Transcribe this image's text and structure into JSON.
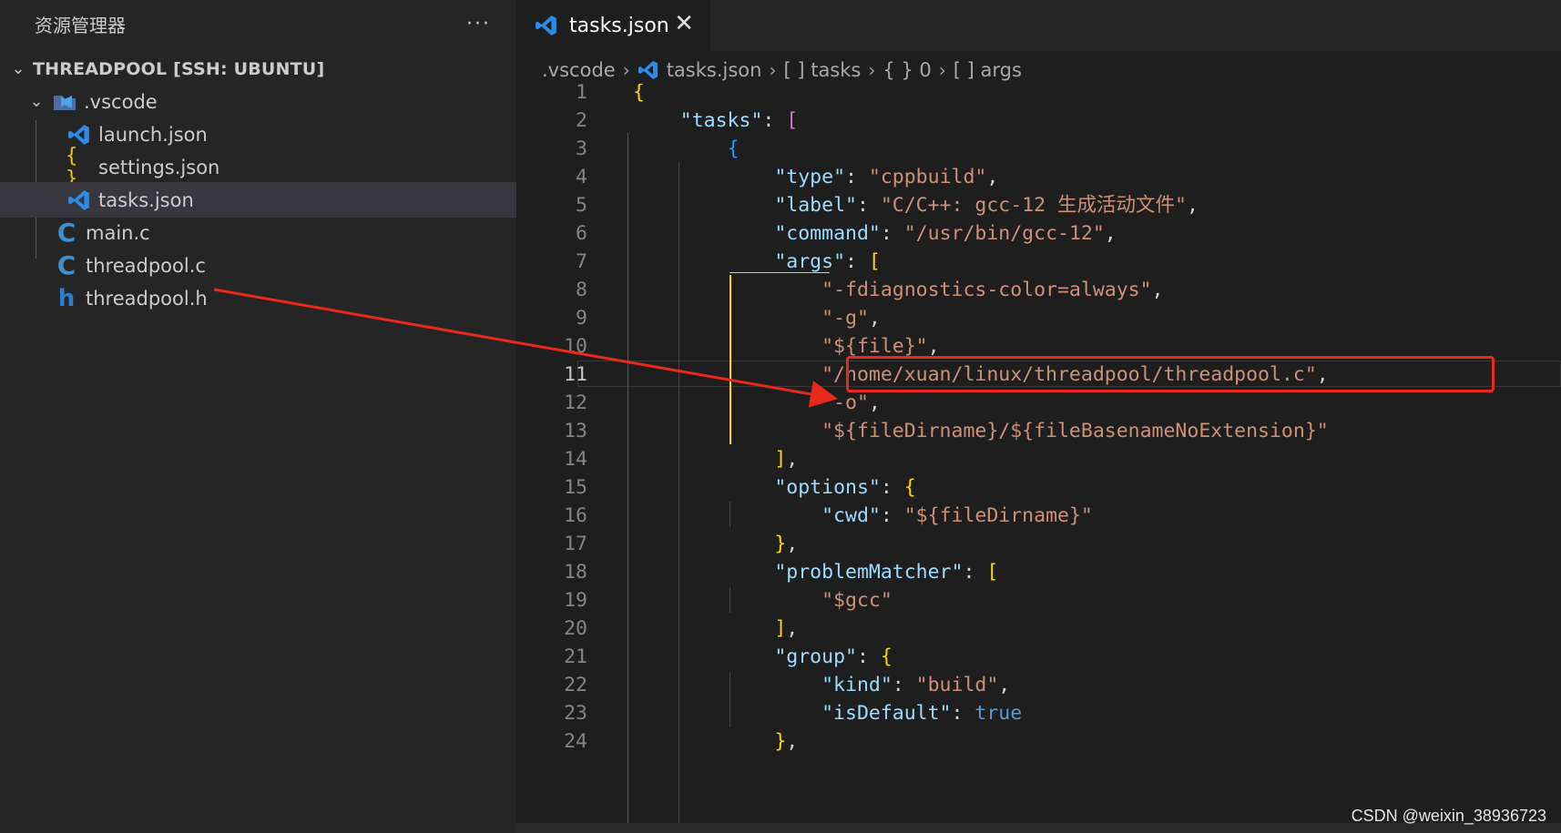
{
  "sidebar": {
    "title": "资源管理器",
    "more": "···",
    "root_label": "THREADPOOL [SSH: UBUNTU]",
    "items": [
      {
        "label": ".vscode",
        "type": "folder"
      },
      {
        "label": "launch.json",
        "type": "vscode-json"
      },
      {
        "label": "settings.json",
        "type": "json"
      },
      {
        "label": "tasks.json",
        "type": "vscode-json",
        "selected": true
      },
      {
        "label": "main.c",
        "type": "c"
      },
      {
        "label": "threadpool.c",
        "type": "c"
      },
      {
        "label": "threadpool.h",
        "type": "h"
      }
    ]
  },
  "tab": {
    "label": "tasks.json",
    "close": "✕"
  },
  "breadcrumb": [
    ".vscode",
    "tasks.json",
    "[ ] tasks",
    "{ } 0",
    "[ ] args"
  ],
  "code": {
    "active_line": 11,
    "line_numbers": [
      "1",
      "2",
      "3",
      "4",
      "5",
      "6",
      "7",
      "8",
      "9",
      "10",
      "11",
      "12",
      "13",
      "14",
      "15",
      "16",
      "17",
      "18",
      "19",
      "20",
      "21",
      "22",
      "23",
      "24"
    ]
  },
  "watermark": "CSDN @weixin_38936723",
  "colors": {
    "highlight": "#e8291b",
    "accent": "#179fff"
  }
}
